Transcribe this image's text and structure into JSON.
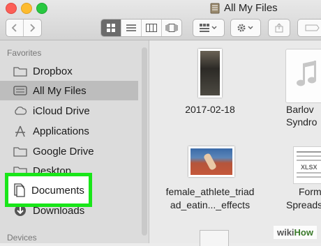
{
  "window": {
    "title": "All My Files",
    "controls": [
      "close",
      "minimize",
      "zoom"
    ]
  },
  "toolbar": {
    "nav": {
      "back_icon": "chevron-left-icon",
      "forward_icon": "chevron-right-icon"
    },
    "view_modes": [
      {
        "name": "icon-view",
        "icon": "grid-icon",
        "selected": true
      },
      {
        "name": "list-view",
        "icon": "list-icon",
        "selected": false
      },
      {
        "name": "column-view",
        "icon": "columns-icon",
        "selected": false
      },
      {
        "name": "cover-flow-view",
        "icon": "coverflow-icon",
        "selected": false
      }
    ],
    "arrange_icon": "arrange-icon",
    "action_icon": "gear-icon",
    "share_icon": "share-icon",
    "tags_icon": "tag-icon"
  },
  "sidebar": {
    "favorites_header": "Favorites",
    "devices_header": "Devices",
    "items": [
      {
        "label": "Dropbox",
        "icon": "folder-icon",
        "selected": false
      },
      {
        "label": "All My Files",
        "icon": "all-files-icon",
        "selected": true
      },
      {
        "label": "iCloud Drive",
        "icon": "cloud-icon",
        "selected": false
      },
      {
        "label": "Applications",
        "icon": "applications-icon",
        "selected": false
      },
      {
        "label": "Google Drive",
        "icon": "folder-icon",
        "selected": false
      },
      {
        "label": "Desktop",
        "icon": "folder-icon",
        "selected": false
      },
      {
        "label": "Documents",
        "icon": "documents-icon",
        "selected": false,
        "highlighted": true
      },
      {
        "label": "Downloads",
        "icon": "downloads-icon",
        "selected": false
      }
    ]
  },
  "files": [
    {
      "name": "2017-02-18",
      "kind": "photo"
    },
    {
      "name_line1": "Barlov",
      "name_line2": "Syndro",
      "kind": "audio"
    },
    {
      "name_line1": "female_athlete_triad",
      "name_line2": "ad_eatin..._effects",
      "kind": "photo"
    },
    {
      "name_line1": "Form",
      "name_line2": "Spreads",
      "kind": "spreadsheet",
      "badge": "XLSX"
    }
  ],
  "watermark": {
    "brand_a": "wiki",
    "brand_b": "How"
  },
  "colors": {
    "highlight": "#19e619",
    "selection": "#bdbdbd"
  }
}
